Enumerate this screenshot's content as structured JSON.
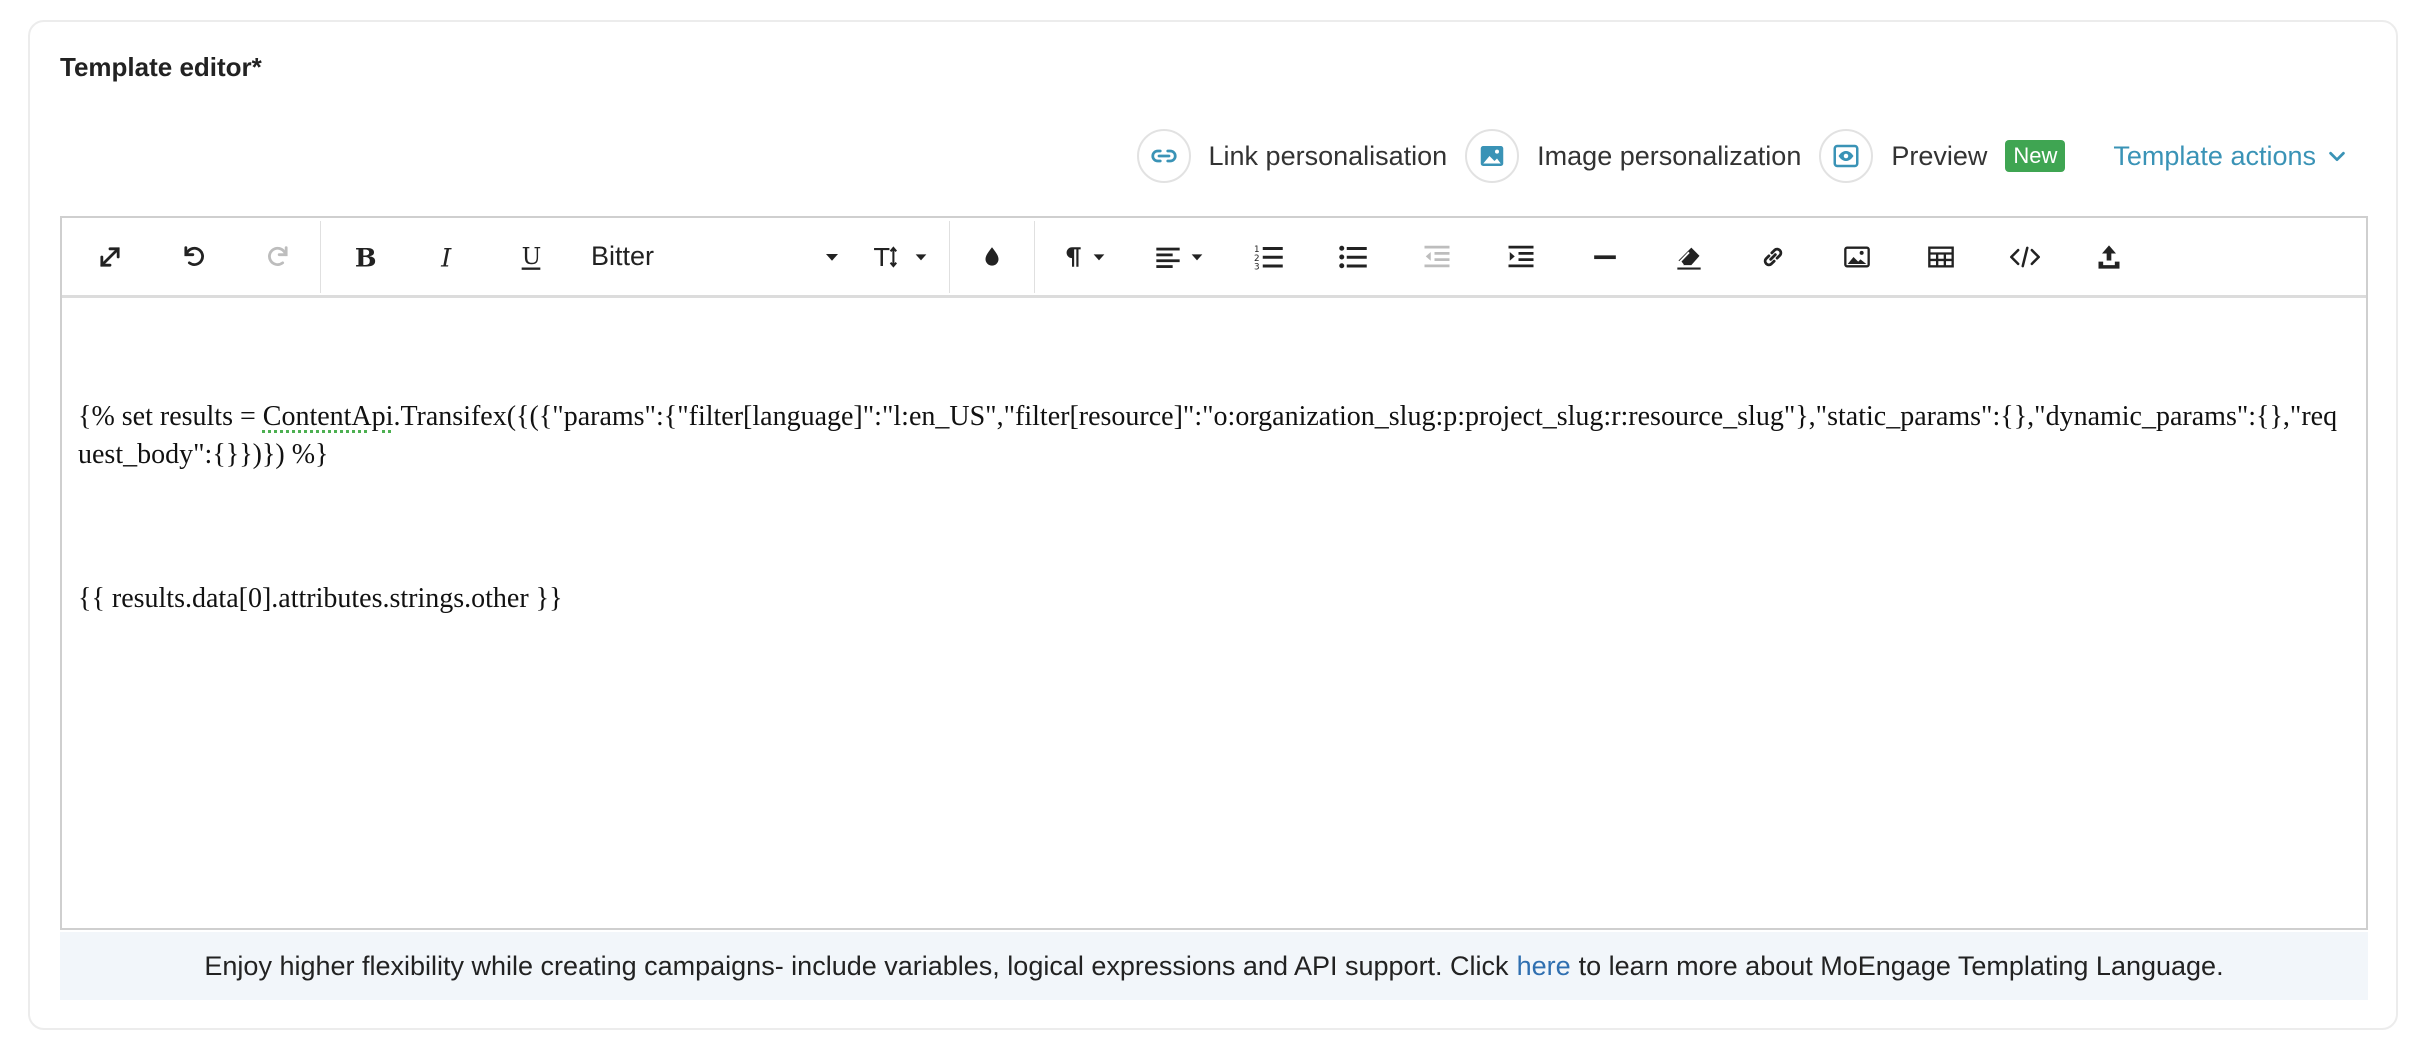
{
  "editor": {
    "title": "Template editor*"
  },
  "actions": {
    "link_personalisation": "Link personalisation",
    "image_personalization": "Image personalization",
    "preview": "Preview",
    "preview_badge": "New",
    "template_actions": "Template actions"
  },
  "toolbar": {
    "font_family": "Bitter",
    "icons": [
      "fullscreen-icon",
      "undo-icon",
      "redo-icon",
      "bold-icon",
      "italic-icon",
      "underline-icon",
      "font-size-icon",
      "text-color-icon",
      "paragraph-format-icon",
      "align-icon",
      "ordered-list-icon",
      "unordered-list-icon",
      "outdent-icon",
      "indent-icon",
      "horizontal-line-icon",
      "clear-format-icon",
      "insert-link-icon",
      "insert-image-icon",
      "insert-table-icon",
      "code-view-icon",
      "upload-icon"
    ]
  },
  "content": {
    "line1_pre": "{% set results = ",
    "line1_spell": "ContentApi",
    "line1_post": ".Transifex({({\"params\":{\"filter[language]\":\"l:en_US\",\"filter[resource]\":\"o:organization_slug:p:project_slug:r:resource_slug\"},\"static_params\":{},\"dynamic_params\":{},\"request_body\":{}})}) %}",
    "line2": "{{ results.data[0].attributes.strings.other }}"
  },
  "footer": {
    "text_before": "Enjoy higher flexibility while creating campaigns- include variables, logical expressions and API support. Click",
    "link": "here",
    "text_after": "to learn more about MoEngage Templating Language."
  },
  "colors": {
    "accent": "#3a93b6",
    "badge": "#3fa552",
    "link": "#2f6fb0",
    "footer_bg": "#f2f6fa"
  }
}
